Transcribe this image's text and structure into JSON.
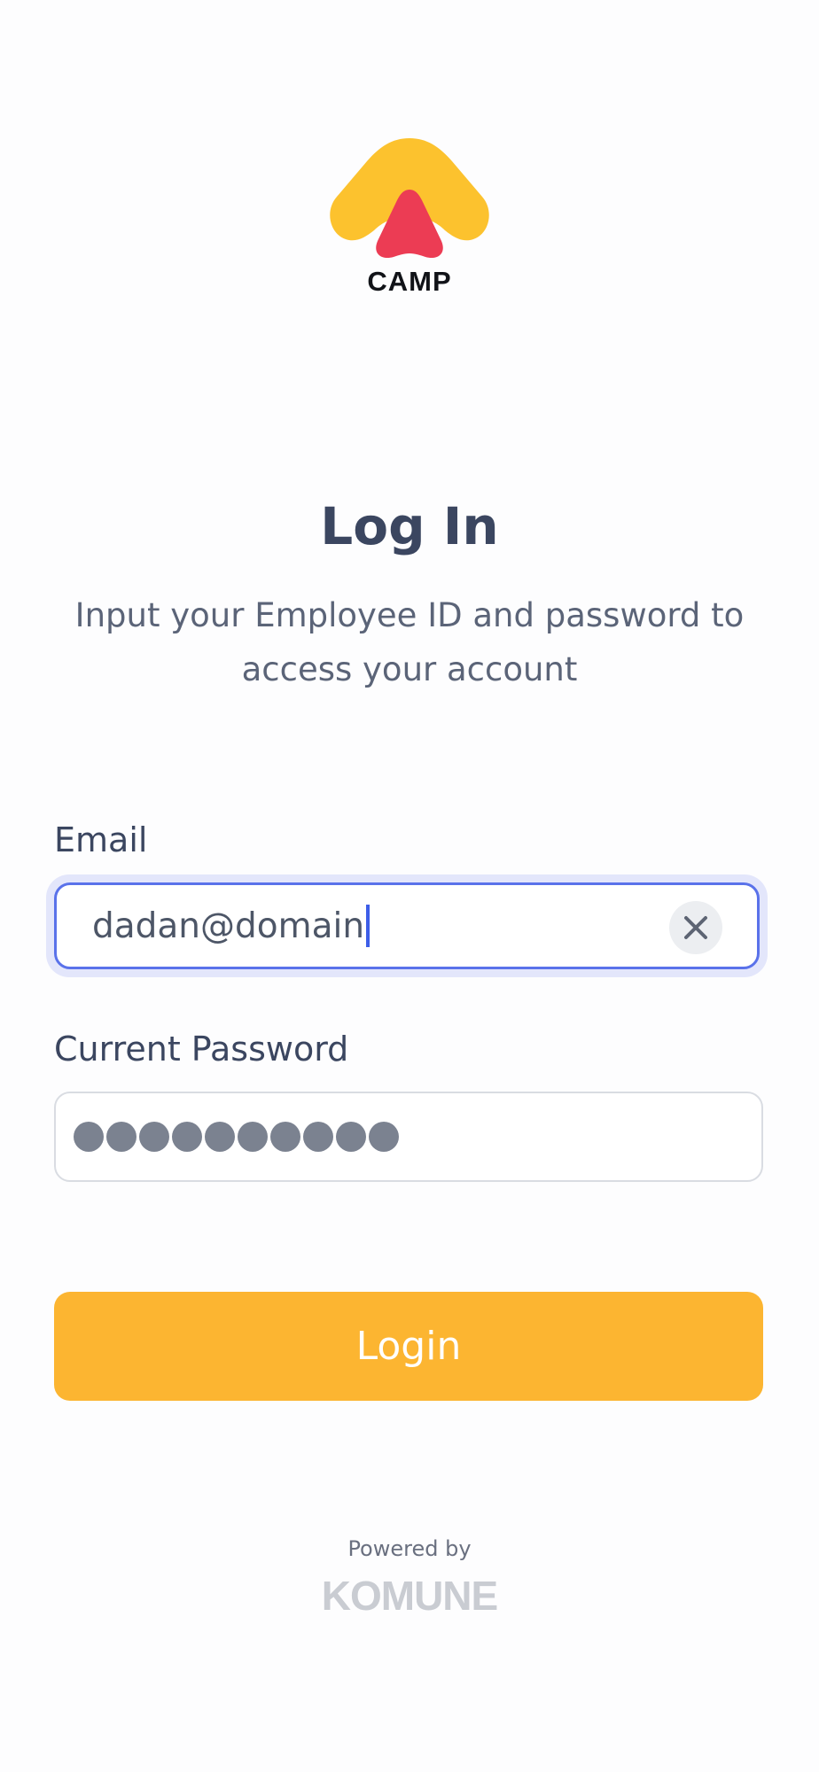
{
  "app": {
    "logo_text": "CAMP"
  },
  "login": {
    "title": "Log In",
    "subtitle": "Input your Employee ID and password to access your account"
  },
  "form": {
    "email_label": "Email",
    "email_value": "dadan@domain",
    "password_label": "Current Password",
    "password_masked_length": 10,
    "login_button_label": "Login"
  },
  "footer": {
    "powered_by": "Powered by",
    "brand": "KOMUNE"
  },
  "colors": {
    "accent": "#fcb531",
    "focus_border": "#5a72ea",
    "logo_yellow": "#fcc22e",
    "logo_red": "#ec3c54",
    "text_primary": "#3b4660"
  },
  "icons": {
    "clear": "close-icon"
  }
}
